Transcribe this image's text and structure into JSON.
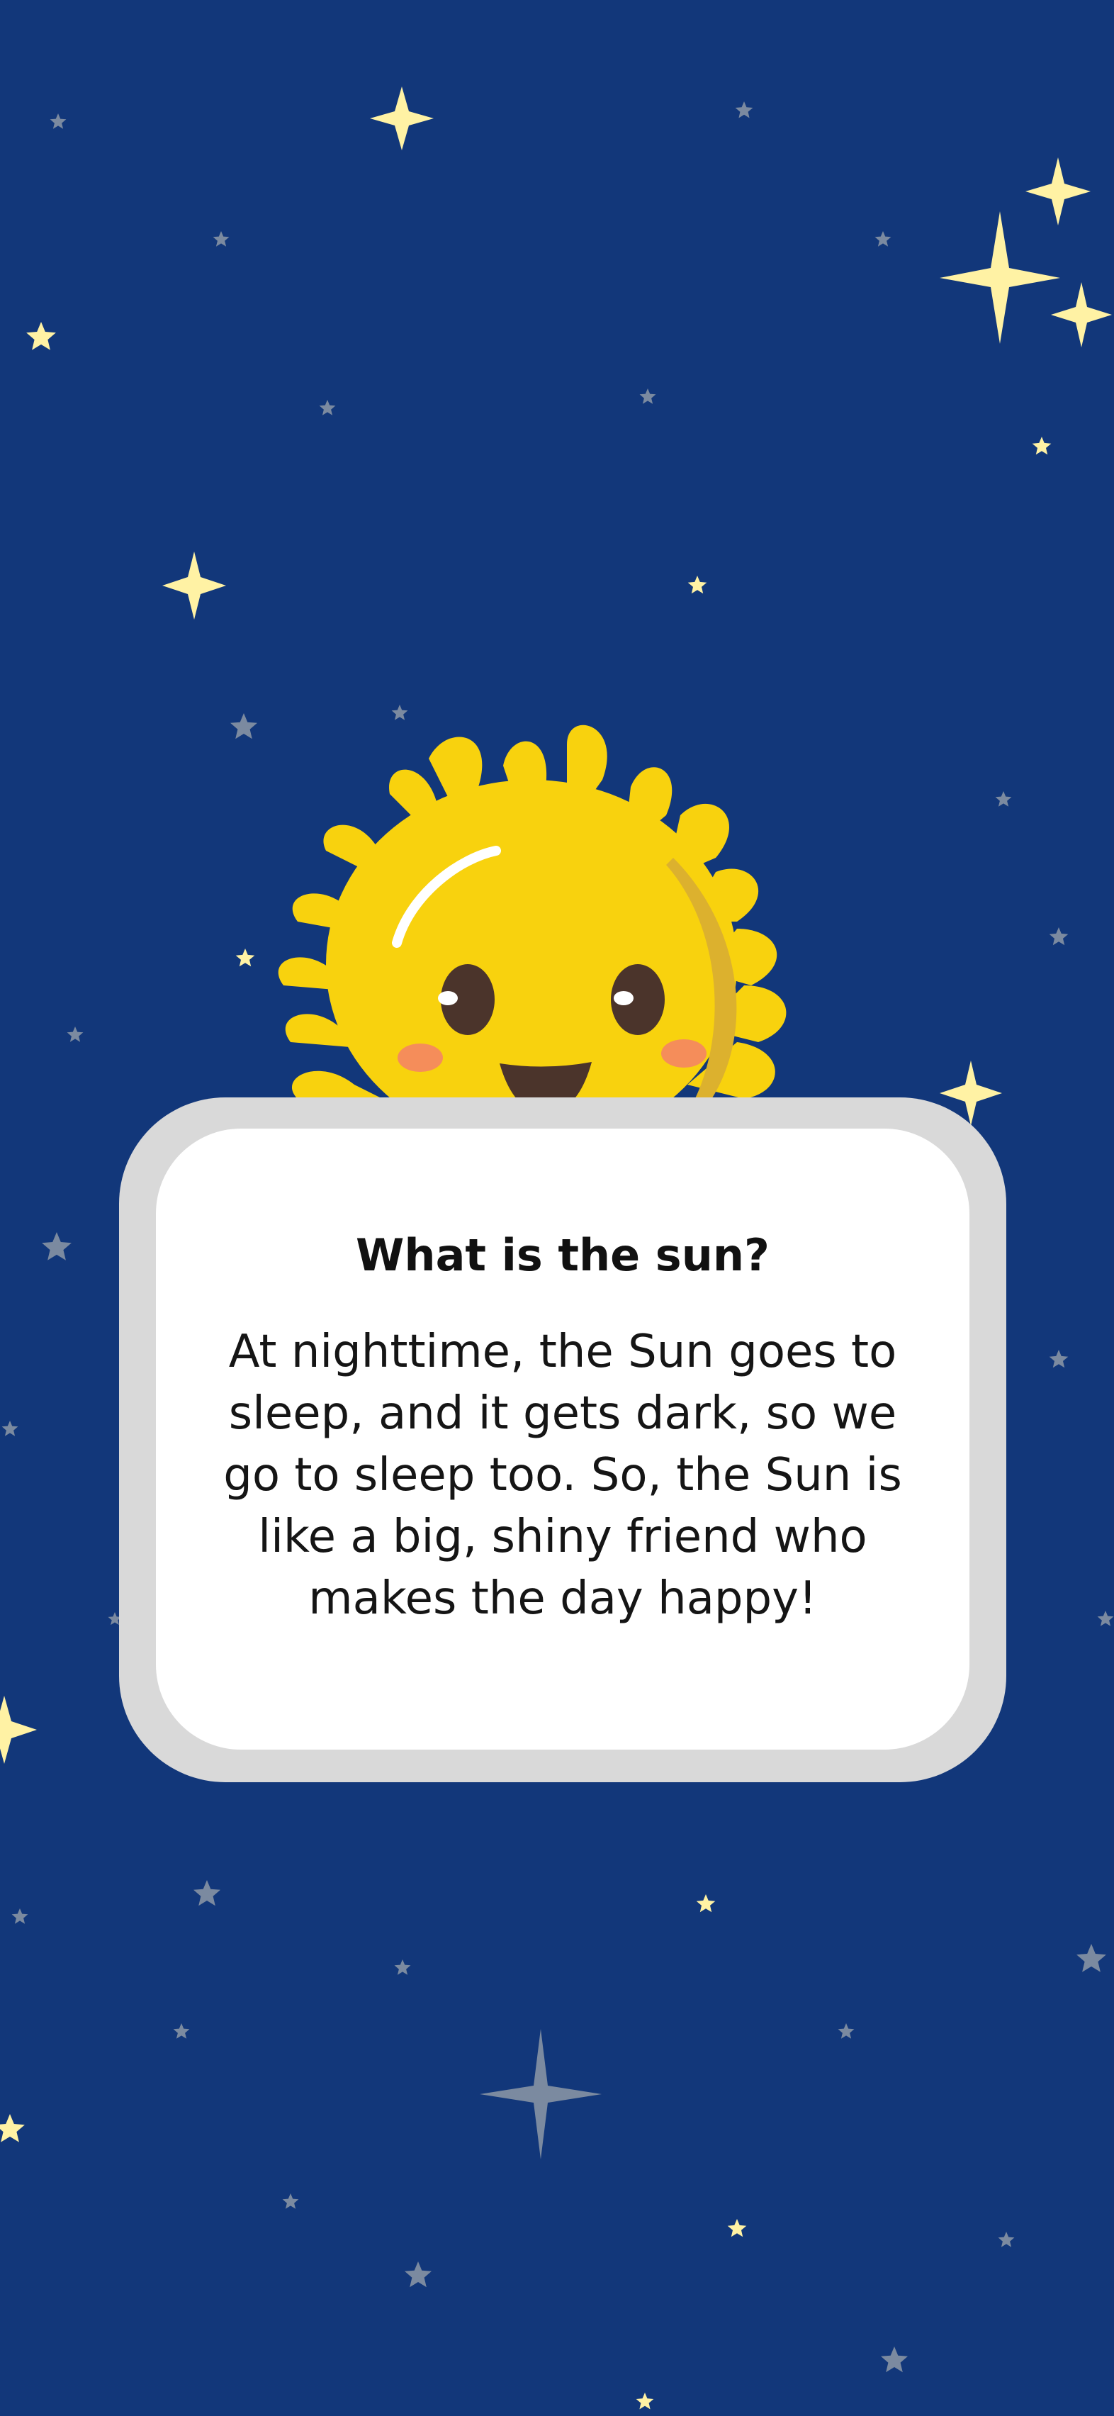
{
  "page": {
    "background_color": "#12377a"
  },
  "colors": {
    "star_bright": "#fff2a4",
    "star_dim": "#7b8aa0",
    "sun_yellow": "#f8d20e",
    "sun_shadow": "#dcb12e",
    "sun_eye": "#4b342b",
    "sun_cheek": "#f58d5a",
    "card_border": "#d9d9d9",
    "card_fill": "#ffffff"
  },
  "illustration": {
    "character": "sun-icon"
  },
  "card": {
    "title": "What is the sun?",
    "body": "At nighttime, the Sun goes to sleep, and it gets dark, so we go to sleep too. So, the Sun is like a big, shiny friend who makes the day happy!"
  }
}
